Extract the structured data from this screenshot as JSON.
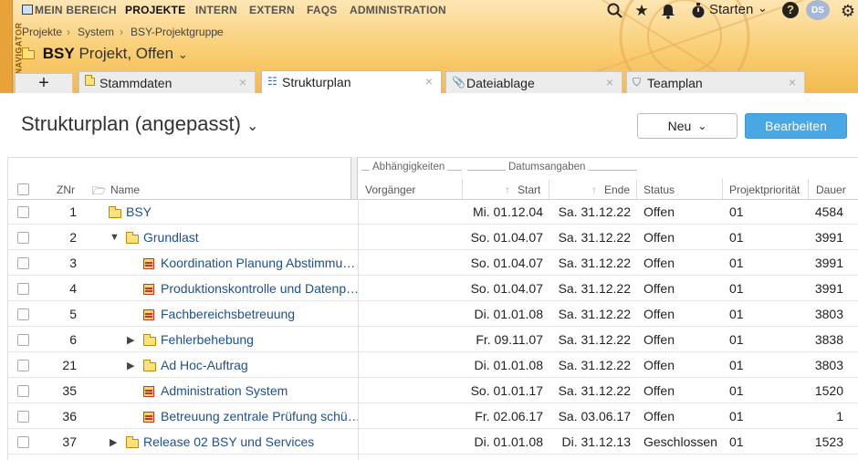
{
  "header": {
    "nav_side_label": "NAVIGATOR",
    "menu": [
      "MEIN BEREICH",
      "PROJEKTE",
      "INTERN",
      "EXTERN",
      "FAQS",
      "ADMINISTRATION"
    ],
    "starten_label": "Starten",
    "avatar_initials": "DS",
    "breadcrumb": [
      "Projekte",
      "System",
      "BSY-Projektgruppe"
    ],
    "project_code": "BSY",
    "project_status": "Projekt, Offen"
  },
  "tabs": [
    {
      "label": "Stammdaten",
      "icon": "folder-icon"
    },
    {
      "label": "Strukturplan",
      "icon": "structure-icon"
    },
    {
      "label": "Dateiablage",
      "icon": "paperclip-icon"
    },
    {
      "label": "Teamplan",
      "icon": "team-icon"
    }
  ],
  "page": {
    "title": "Strukturplan (angepasst)",
    "new_button": "Neu",
    "edit_button": "Bearbeiten"
  },
  "grid": {
    "group_headers": {
      "dependencies": "Abhängigkeiten",
      "dates": "Datumsangaben"
    },
    "columns": {
      "znr": "ZNr",
      "name": "Name",
      "predecessor": "Vorgänger",
      "start": "Start",
      "end": "Ende",
      "status": "Status",
      "priority": "Projektpriorität",
      "duration": "Dauer"
    },
    "rows": [
      {
        "znr": "1",
        "name": "BSY",
        "start": "Mi. 01.12.04",
        "end": "Sa. 31.12.22",
        "status": "Offen",
        "priority": "01",
        "duration": "4584",
        "icon": "folder",
        "level": 0,
        "expander": ""
      },
      {
        "znr": "2",
        "name": "Grundlast",
        "start": "So. 01.04.07",
        "end": "Sa. 31.12.22",
        "status": "Offen",
        "priority": "01",
        "duration": "3991",
        "icon": "folder",
        "level": 1,
        "expander": "▼"
      },
      {
        "znr": "3",
        "name": "Koordination Planung Abstimmu…",
        "start": "So. 01.04.07",
        "end": "Sa. 31.12.22",
        "status": "Offen",
        "priority": "01",
        "duration": "3991",
        "icon": "task",
        "level": 2,
        "expander": ""
      },
      {
        "znr": "4",
        "name": "Produktionskontrolle und Datenp…",
        "start": "So. 01.04.07",
        "end": "Sa. 31.12.22",
        "status": "Offen",
        "priority": "01",
        "duration": "3991",
        "icon": "task",
        "level": 2,
        "expander": ""
      },
      {
        "znr": "5",
        "name": "Fachbereichsbetreuung",
        "start": "Di. 01.01.08",
        "end": "Sa. 31.12.22",
        "status": "Offen",
        "priority": "01",
        "duration": "3803",
        "icon": "task",
        "level": 2,
        "expander": ""
      },
      {
        "znr": "6",
        "name": "Fehlerbehebung",
        "start": "Fr. 09.11.07",
        "end": "Sa. 31.12.22",
        "status": "Offen",
        "priority": "01",
        "duration": "3838",
        "icon": "folder",
        "level": 2,
        "expander": "▶"
      },
      {
        "znr": "21",
        "name": "Ad Hoc-Auftrag",
        "start": "Di. 01.01.08",
        "end": "Sa. 31.12.22",
        "status": "Offen",
        "priority": "01",
        "duration": "3803",
        "icon": "folder",
        "level": 2,
        "expander": "▶"
      },
      {
        "znr": "35",
        "name": "Administration System",
        "start": "So. 01.01.17",
        "end": "Sa. 31.12.22",
        "status": "Offen",
        "priority": "01",
        "duration": "1520",
        "icon": "task",
        "level": 2,
        "expander": ""
      },
      {
        "znr": "36",
        "name": "Betreuung zentrale Prüfung schü…",
        "start": "Fr. 02.06.17",
        "end": "Sa. 03.06.17",
        "status": "Offen",
        "priority": "01",
        "duration": "1",
        "icon": "task",
        "level": 2,
        "expander": ""
      },
      {
        "znr": "37",
        "name": "Release 02 BSY und Services",
        "start": "Di. 01.01.08",
        "end": "Di. 31.12.13",
        "status": "Geschlossen",
        "priority": "01",
        "duration": "1523",
        "icon": "folder",
        "level": 1,
        "expander": "▶"
      }
    ]
  }
}
